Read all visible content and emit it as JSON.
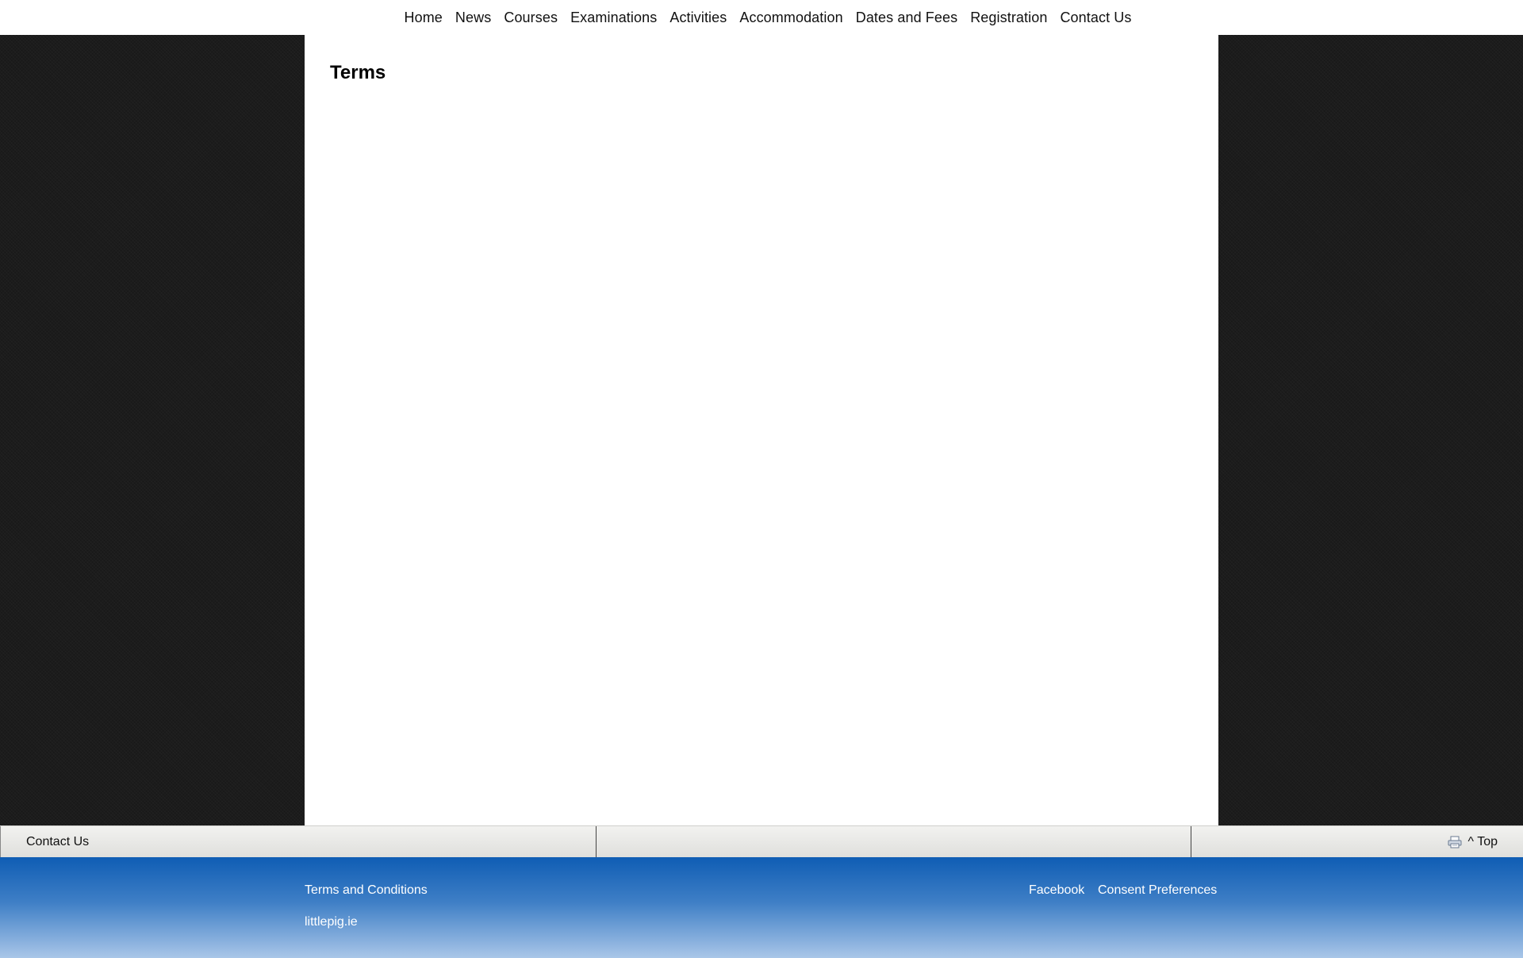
{
  "nav": {
    "items": [
      "Home",
      "News",
      "Courses",
      "Examinations",
      "Activities",
      "Accommodation",
      "Dates and Fees",
      "Registration",
      "Contact Us"
    ]
  },
  "main": {
    "title": "Terms"
  },
  "bar": {
    "contact_label": "Contact Us",
    "print_icon": "printer-icon",
    "top_label": "^ Top"
  },
  "footer": {
    "terms_label": "Terms and Conditions",
    "site_label": "littlepig.ie",
    "facebook_label": "Facebook",
    "consent_label": "Consent Preferences"
  },
  "colors": {
    "footer_top": "#0f5db4",
    "footer_bottom": "#a9c6e8",
    "side_bg": "#1c1c1c"
  }
}
